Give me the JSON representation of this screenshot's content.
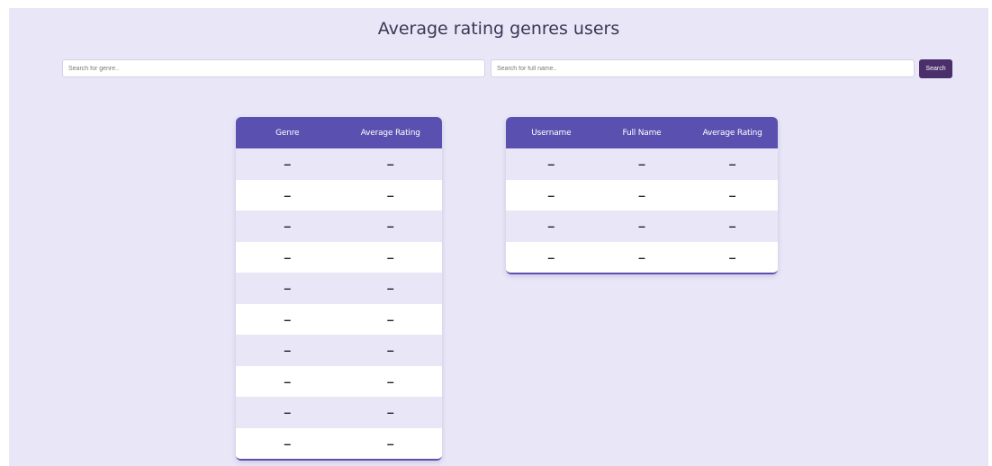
{
  "header": {
    "title": "Average rating genres users"
  },
  "search": {
    "genre_placeholder": "Search for genre..",
    "name_placeholder": "Search for full name..",
    "button_label": "Search"
  },
  "genre_table": {
    "columns": [
      "Genre",
      "Average Rating"
    ],
    "rows": [
      [
        "–",
        "–"
      ],
      [
        "–",
        "–"
      ],
      [
        "–",
        "–"
      ],
      [
        "–",
        "–"
      ],
      [
        "–",
        "–"
      ],
      [
        "–",
        "–"
      ],
      [
        "–",
        "–"
      ],
      [
        "–",
        "–"
      ],
      [
        "–",
        "–"
      ],
      [
        "–",
        "–"
      ]
    ]
  },
  "user_table": {
    "columns": [
      "Username",
      "Full Name",
      "Average Rating"
    ],
    "rows": [
      [
        "–",
        "–",
        "–"
      ],
      [
        "–",
        "–",
        "–"
      ],
      [
        "–",
        "–",
        "–"
      ],
      [
        "–",
        "–",
        "–"
      ]
    ]
  },
  "colors": {
    "background": "#e8e6f7",
    "header": "#5a50b0",
    "button": "#4a2f6b"
  }
}
